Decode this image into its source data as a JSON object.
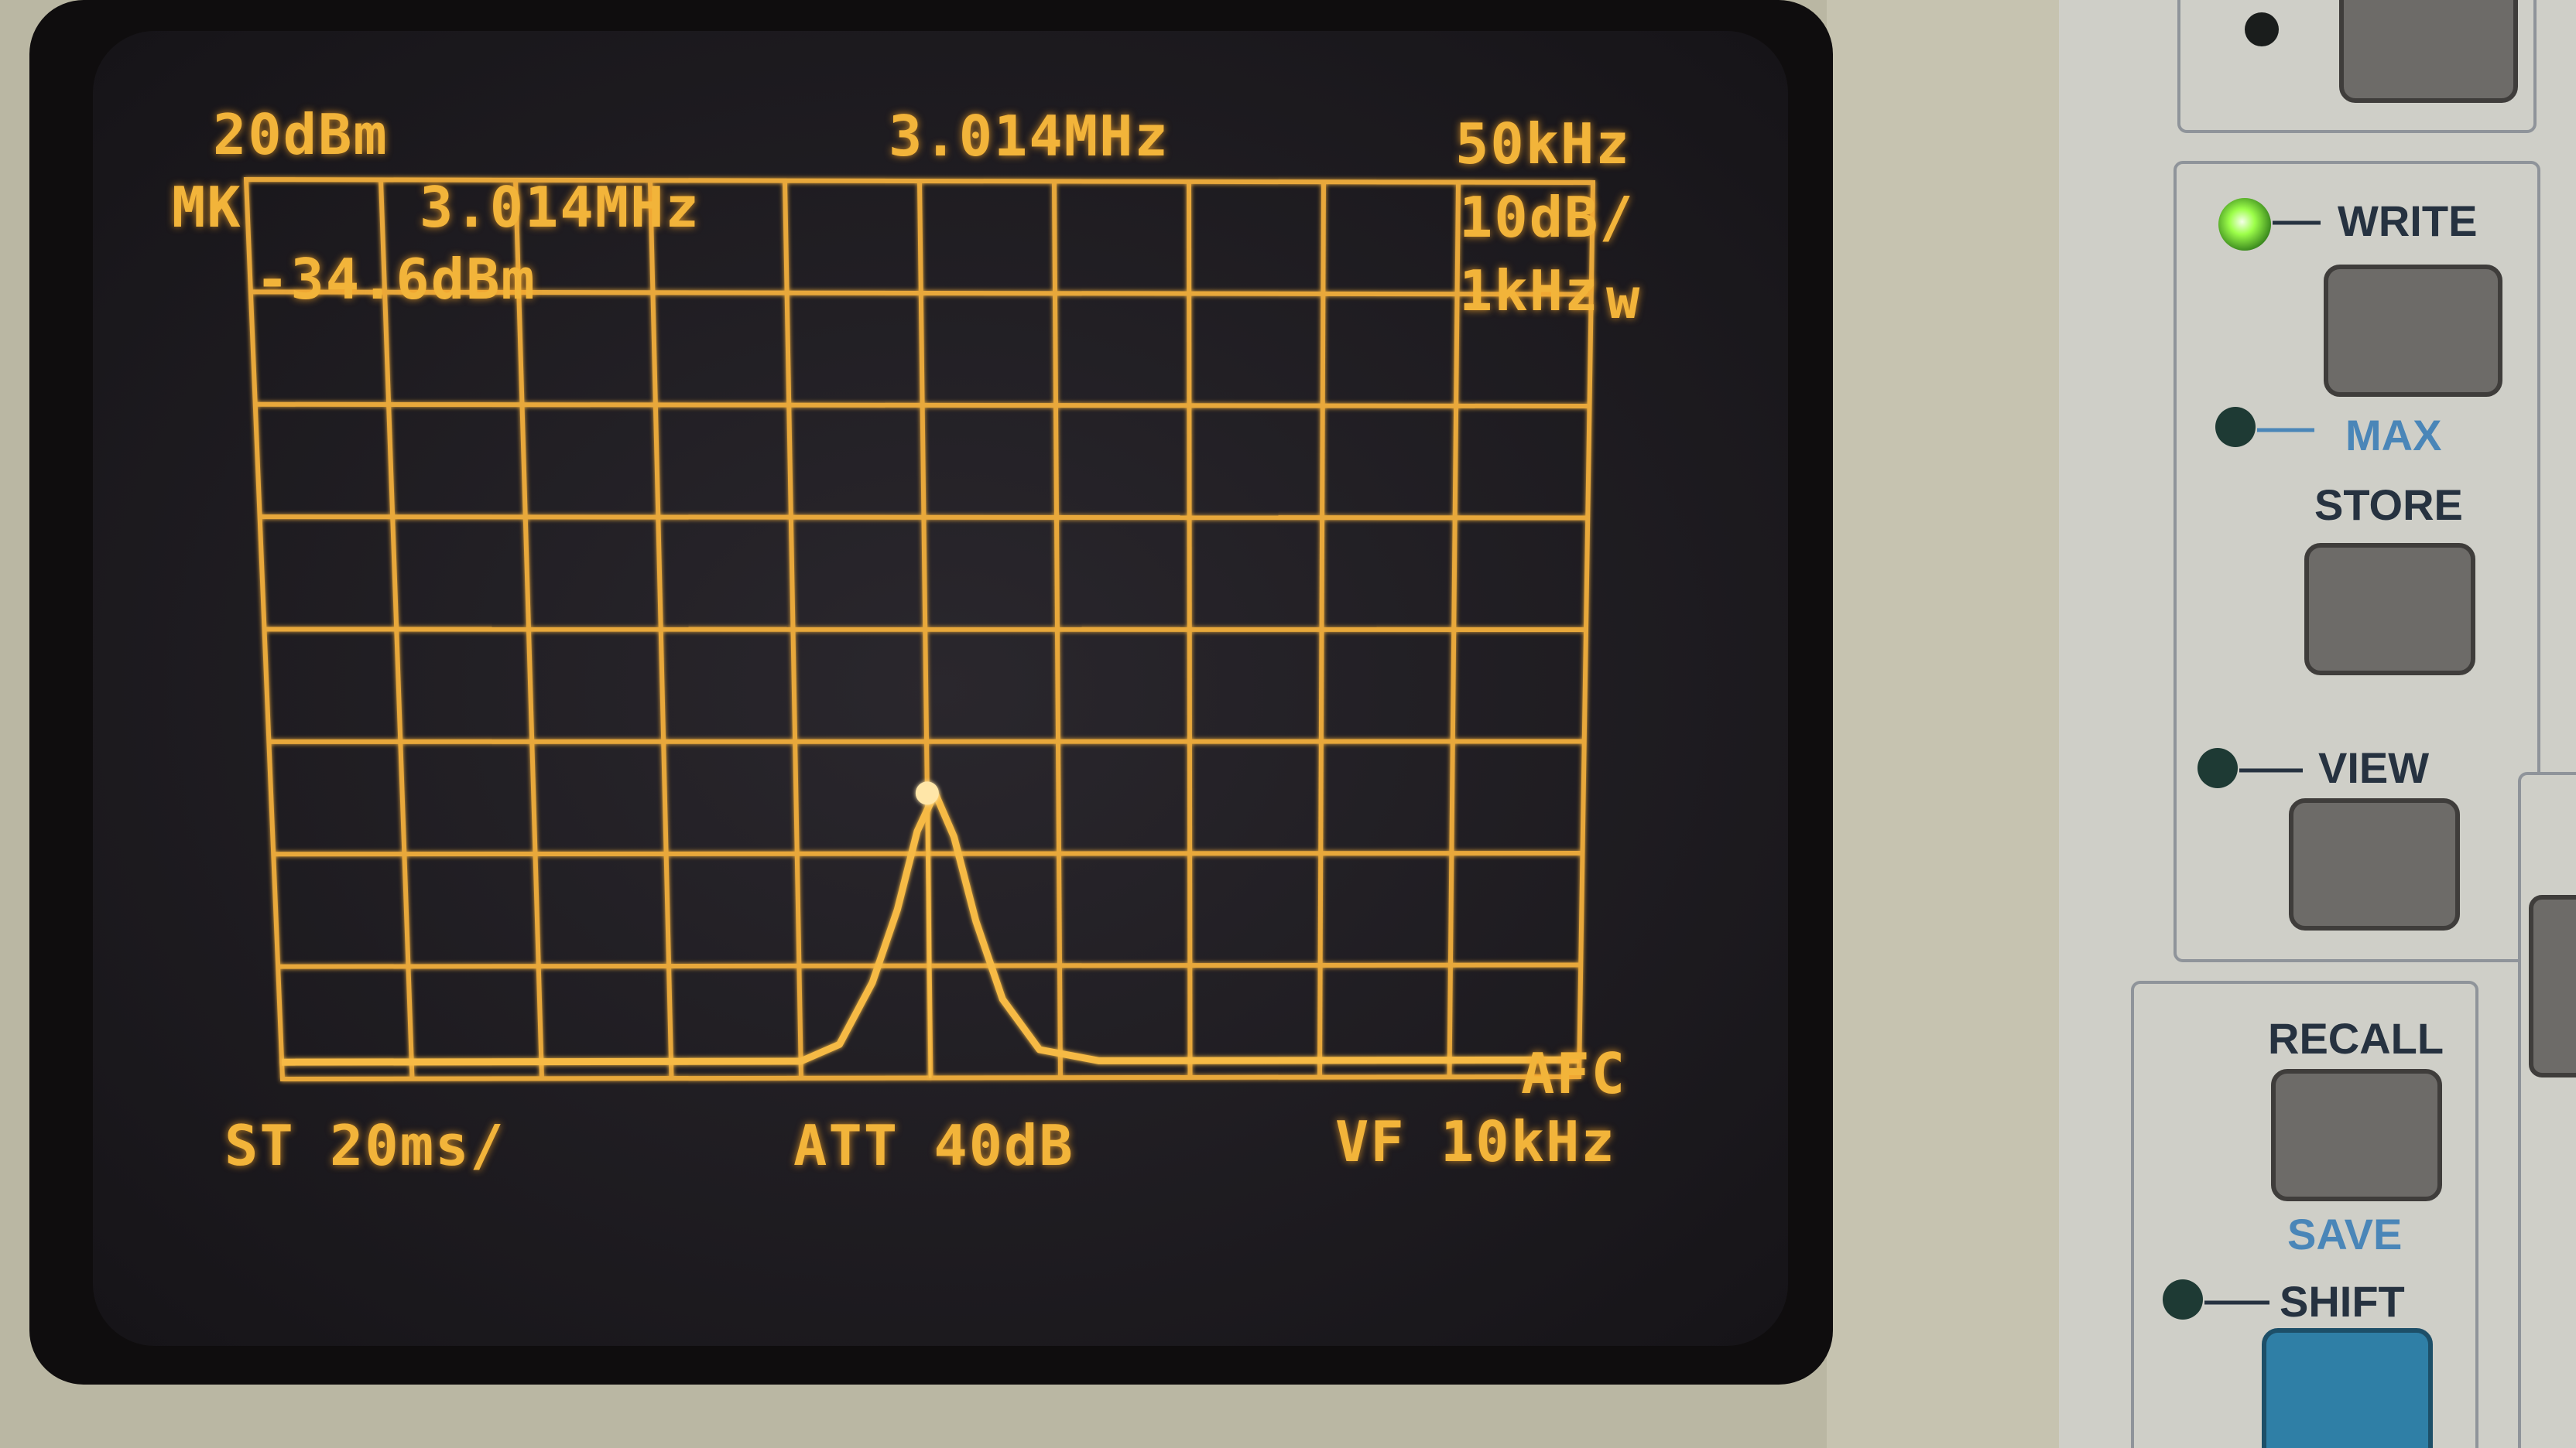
{
  "colors": {
    "trace": "#f2b43a",
    "screen_background": "#201d22",
    "bezel": "#0f0d0e",
    "case": "#b9b6a2",
    "panel": "#c8c8c0",
    "button": "#6d6b68",
    "shift_button": "#2f7fa6",
    "led_on": "#8fff4a",
    "led_off": "#1e3a34",
    "label_dark": "#263240",
    "label_blue": "#4a86b8"
  },
  "screen": {
    "ref_level": "20dBm",
    "center_freq": "3.014MHz",
    "span": "50kHz",
    "marker_label": "MK",
    "marker_freq": "3.014MHz",
    "marker_level": "-34.6dBm",
    "scale": "10dB/",
    "rbw": "1kHz",
    "rbw_flag": "w",
    "afc": "AFC",
    "sweep_time": "ST 20ms/",
    "attenuation": "ATT 40dB",
    "video_filter": "VF 10kHz"
  },
  "panel": {
    "write": "WRITE",
    "max": "MAX",
    "store": "STORE",
    "view": "VIEW",
    "recall": "RECALL",
    "save": "SAVE",
    "shift": "SHIFT"
  },
  "chart_data": {
    "type": "line",
    "title": "",
    "xlabel": "",
    "ylabel": "",
    "x_unit": "MHz",
    "y_unit": "dBm",
    "center_MHz": 3.014,
    "span_kHz": 50,
    "ref_level_dBm": 20,
    "scale_dB_per_div": 10,
    "grid": {
      "x_divisions": 10,
      "y_divisions": 8,
      "visible": true
    },
    "xlim": [
      2.989,
      3.039
    ],
    "ylim": [
      -60,
      20
    ],
    "x": [
      2.989,
      3.009,
      3.0105,
      3.0118,
      3.0128,
      3.0136,
      3.0143,
      3.015,
      3.0158,
      3.0168,
      3.0182,
      3.0205,
      3.039
    ],
    "y": [
      -58.5,
      -58.5,
      -57,
      -51.5,
      -45,
      -38,
      -34.6,
      -38.5,
      -46,
      -53,
      -57.5,
      -58.5,
      -58.5
    ],
    "marker": {
      "x": 3.014,
      "y": -34.6
    }
  }
}
